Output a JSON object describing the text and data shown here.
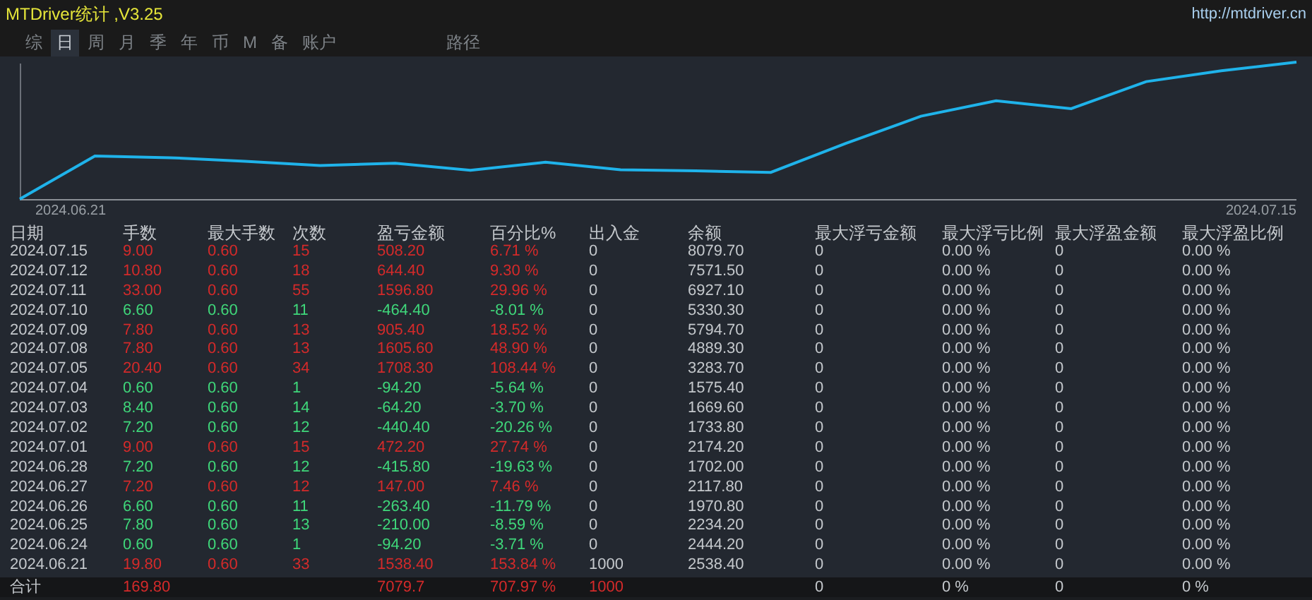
{
  "window": {
    "title": "MTDriver统计 ,V3.25",
    "url": "http://mtdriver.cn"
  },
  "tabs": [
    {
      "label": "综",
      "selected": false
    },
    {
      "label": "日",
      "selected": true
    },
    {
      "label": "周",
      "selected": false
    },
    {
      "label": "月",
      "selected": false
    },
    {
      "label": "季",
      "selected": false
    },
    {
      "label": "年",
      "selected": false
    },
    {
      "label": "币",
      "selected": false
    },
    {
      "label": "M",
      "selected": false
    },
    {
      "label": "备",
      "selected": false
    },
    {
      "label": "账户",
      "selected": false
    },
    {
      "label": "路径",
      "selected": false
    }
  ],
  "chart": {
    "start_label": "2024.06.21",
    "end_label": "2024.07.15"
  },
  "table": {
    "columns": [
      "日期",
      "手数",
      "最大手数",
      "次数",
      "盈亏金额",
      "百分比%",
      "出入金",
      "余额",
      "最大浮亏金额",
      "最大浮亏比例",
      "最大浮盈金额",
      "最大浮盈比例"
    ],
    "rows": [
      {
        "kind": "profit",
        "cells": [
          "2024.07.15",
          "9.00",
          "0.60",
          "15",
          "508.20",
          "6.71 %",
          "0",
          "8079.70",
          "0",
          "0.00 %",
          "0",
          "0.00 %"
        ]
      },
      {
        "kind": "profit",
        "cells": [
          "2024.07.12",
          "10.80",
          "0.60",
          "18",
          "644.40",
          "9.30 %",
          "0",
          "7571.50",
          "0",
          "0.00 %",
          "0",
          "0.00 %"
        ]
      },
      {
        "kind": "profit",
        "cells": [
          "2024.07.11",
          "33.00",
          "0.60",
          "55",
          "1596.80",
          "29.96 %",
          "0",
          "6927.10",
          "0",
          "0.00 %",
          "0",
          "0.00 %"
        ]
      },
      {
        "kind": "loss",
        "cells": [
          "2024.07.10",
          "6.60",
          "0.60",
          "11",
          "-464.40",
          "-8.01 %",
          "0",
          "5330.30",
          "0",
          "0.00 %",
          "0",
          "0.00 %"
        ]
      },
      {
        "kind": "profit",
        "cells": [
          "2024.07.09",
          "7.80",
          "0.60",
          "13",
          "905.40",
          "18.52 %",
          "0",
          "5794.70",
          "0",
          "0.00 %",
          "0",
          "0.00 %"
        ]
      },
      {
        "kind": "profit",
        "cells": [
          "2024.07.08",
          "7.80",
          "0.60",
          "13",
          "1605.60",
          "48.90 %",
          "0",
          "4889.30",
          "0",
          "0.00 %",
          "0",
          "0.00 %"
        ]
      },
      {
        "kind": "profit",
        "cells": [
          "2024.07.05",
          "20.40",
          "0.60",
          "34",
          "1708.30",
          "108.44 %",
          "0",
          "3283.70",
          "0",
          "0.00 %",
          "0",
          "0.00 %"
        ]
      },
      {
        "kind": "loss",
        "cells": [
          "2024.07.04",
          "0.60",
          "0.60",
          "1",
          "-94.20",
          "-5.64 %",
          "0",
          "1575.40",
          "0",
          "0.00 %",
          "0",
          "0.00 %"
        ]
      },
      {
        "kind": "loss",
        "cells": [
          "2024.07.03",
          "8.40",
          "0.60",
          "14",
          "-64.20",
          "-3.70 %",
          "0",
          "1669.60",
          "0",
          "0.00 %",
          "0",
          "0.00 %"
        ]
      },
      {
        "kind": "loss",
        "cells": [
          "2024.07.02",
          "7.20",
          "0.60",
          "12",
          "-440.40",
          "-20.26 %",
          "0",
          "1733.80",
          "0",
          "0.00 %",
          "0",
          "0.00 %"
        ]
      },
      {
        "kind": "profit",
        "cells": [
          "2024.07.01",
          "9.00",
          "0.60",
          "15",
          "472.20",
          "27.74 %",
          "0",
          "2174.20",
          "0",
          "0.00 %",
          "0",
          "0.00 %"
        ]
      },
      {
        "kind": "loss",
        "cells": [
          "2024.06.28",
          "7.20",
          "0.60",
          "12",
          "-415.80",
          "-19.63 %",
          "0",
          "1702.00",
          "0",
          "0.00 %",
          "0",
          "0.00 %"
        ]
      },
      {
        "kind": "profit",
        "cells": [
          "2024.06.27",
          "7.20",
          "0.60",
          "12",
          "147.00",
          "7.46 %",
          "0",
          "2117.80",
          "0",
          "0.00 %",
          "0",
          "0.00 %"
        ]
      },
      {
        "kind": "loss",
        "cells": [
          "2024.06.26",
          "6.60",
          "0.60",
          "11",
          "-263.40",
          "-11.79 %",
          "0",
          "1970.80",
          "0",
          "0.00 %",
          "0",
          "0.00 %"
        ]
      },
      {
        "kind": "loss",
        "cells": [
          "2024.06.25",
          "7.80",
          "0.60",
          "13",
          "-210.00",
          "-8.59 %",
          "0",
          "2234.20",
          "0",
          "0.00 %",
          "0",
          "0.00 %"
        ]
      },
      {
        "kind": "loss",
        "cells": [
          "2024.06.24",
          "0.60",
          "0.60",
          "1",
          "-94.20",
          "-3.71 %",
          "0",
          "2444.20",
          "0",
          "0.00 %",
          "0",
          "0.00 %"
        ]
      },
      {
        "kind": "profit",
        "cells": [
          "2024.06.21",
          "19.80",
          "0.60",
          "33",
          "1538.40",
          "153.84 %",
          "1000",
          "2538.40",
          "0",
          "0.00 %",
          "0",
          "0.00 %"
        ]
      }
    ],
    "total": {
      "label": "合计",
      "lots": "169.80",
      "pnl": "7079.7",
      "percent": "707.97 %",
      "cash": "1000",
      "max_float_loss": "0",
      "max_float_loss_pct": "0 %",
      "max_float_profit": "0",
      "max_float_profit_pct": "0 %"
    }
  }
}
